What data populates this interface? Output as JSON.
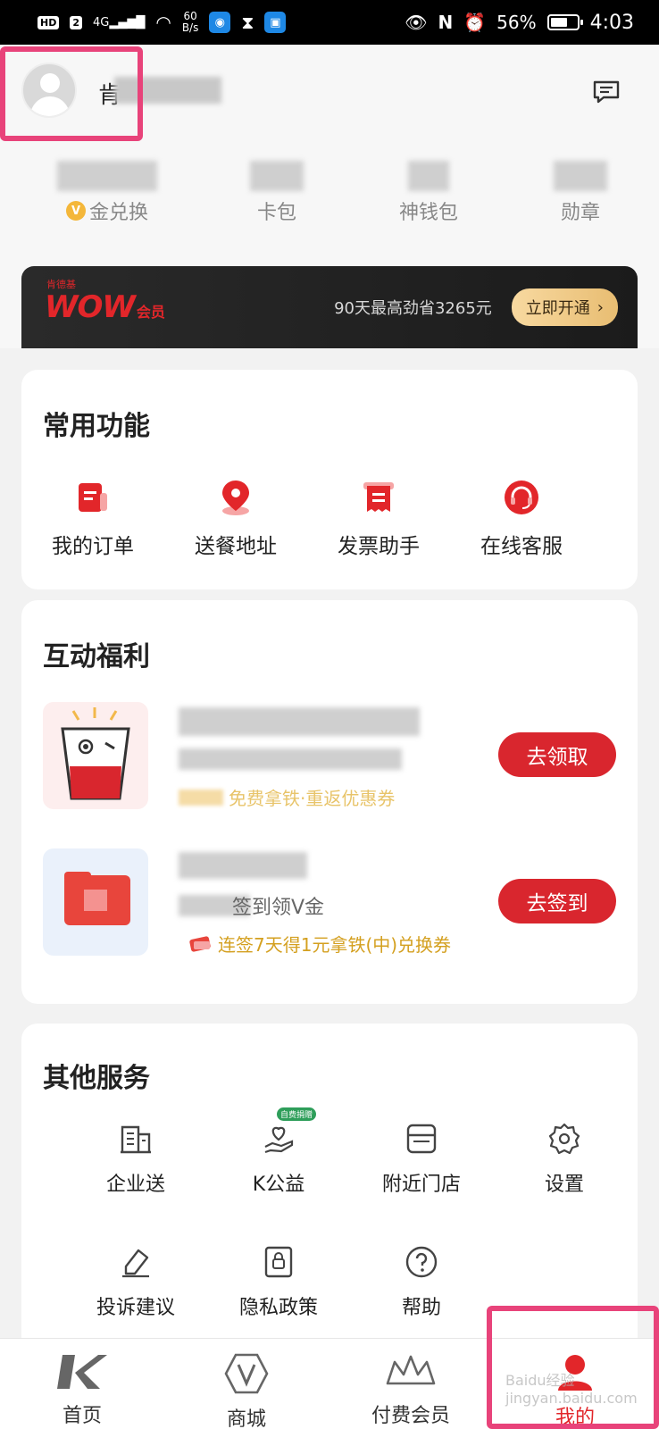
{
  "status_bar": {
    "hd": "HD",
    "sim": "2",
    "net_type": "4G",
    "net_speed_value": "60",
    "net_speed_unit": "B/s",
    "battery": "56%",
    "time": "4:03",
    "battery_level": 0.56
  },
  "profile": {
    "name_visible": "肯"
  },
  "stats": [
    {
      "label": "金兑换",
      "icon": "v-coin-icon"
    },
    {
      "label": "卡包"
    },
    {
      "label": "神钱包"
    },
    {
      "label": "勋章"
    }
  ],
  "banner": {
    "brand_small": "肯德基",
    "brand": "WOW",
    "brand_suffix": "会员",
    "promo": "90天最高劲省3265元",
    "button": "立即开通",
    "button_arrow": "›"
  },
  "common_functions": {
    "title": "常用功能",
    "items": [
      {
        "label": "我的订单",
        "icon": "order-icon"
      },
      {
        "label": "送餐地址",
        "icon": "location-icon"
      },
      {
        "label": "发票助手",
        "icon": "invoice-icon"
      },
      {
        "label": "在线客服",
        "icon": "customer-service-icon"
      }
    ]
  },
  "welfare": {
    "title": "互动福利",
    "rows": [
      {
        "button": "去领取",
        "tag": "免费拿铁·重返优惠券"
      },
      {
        "subtitle": "签到领V金",
        "button": "去签到",
        "tag": "连签7天得1元拿铁(中)兑换券"
      }
    ]
  },
  "other_services": {
    "title": "其他服务",
    "items": [
      {
        "label": "企业送",
        "icon": "building-icon"
      },
      {
        "label": "K公益",
        "icon": "charity-icon",
        "badge": "自费捐赠"
      },
      {
        "label": "附近门店",
        "icon": "store-icon"
      },
      {
        "label": "设置",
        "icon": "gear-icon"
      },
      {
        "label": "投诉建议",
        "icon": "feedback-icon"
      },
      {
        "label": "隐私政策",
        "icon": "privacy-icon"
      },
      {
        "label": "帮助",
        "icon": "help-icon"
      }
    ]
  },
  "bottom_nav": [
    {
      "label": "首页",
      "icon": "k-logo-icon"
    },
    {
      "label": "商城",
      "icon": "v-shield-icon"
    },
    {
      "label": "付费会员",
      "icon": "crown-icon"
    },
    {
      "label": "我的",
      "icon": "user-icon",
      "active": true
    }
  ],
  "watermark": "Baidu经验 jingyan.baidu.com",
  "colors": {
    "accent": "#d9262e",
    "highlight": "#e8437a",
    "gold": "#d4a020"
  }
}
